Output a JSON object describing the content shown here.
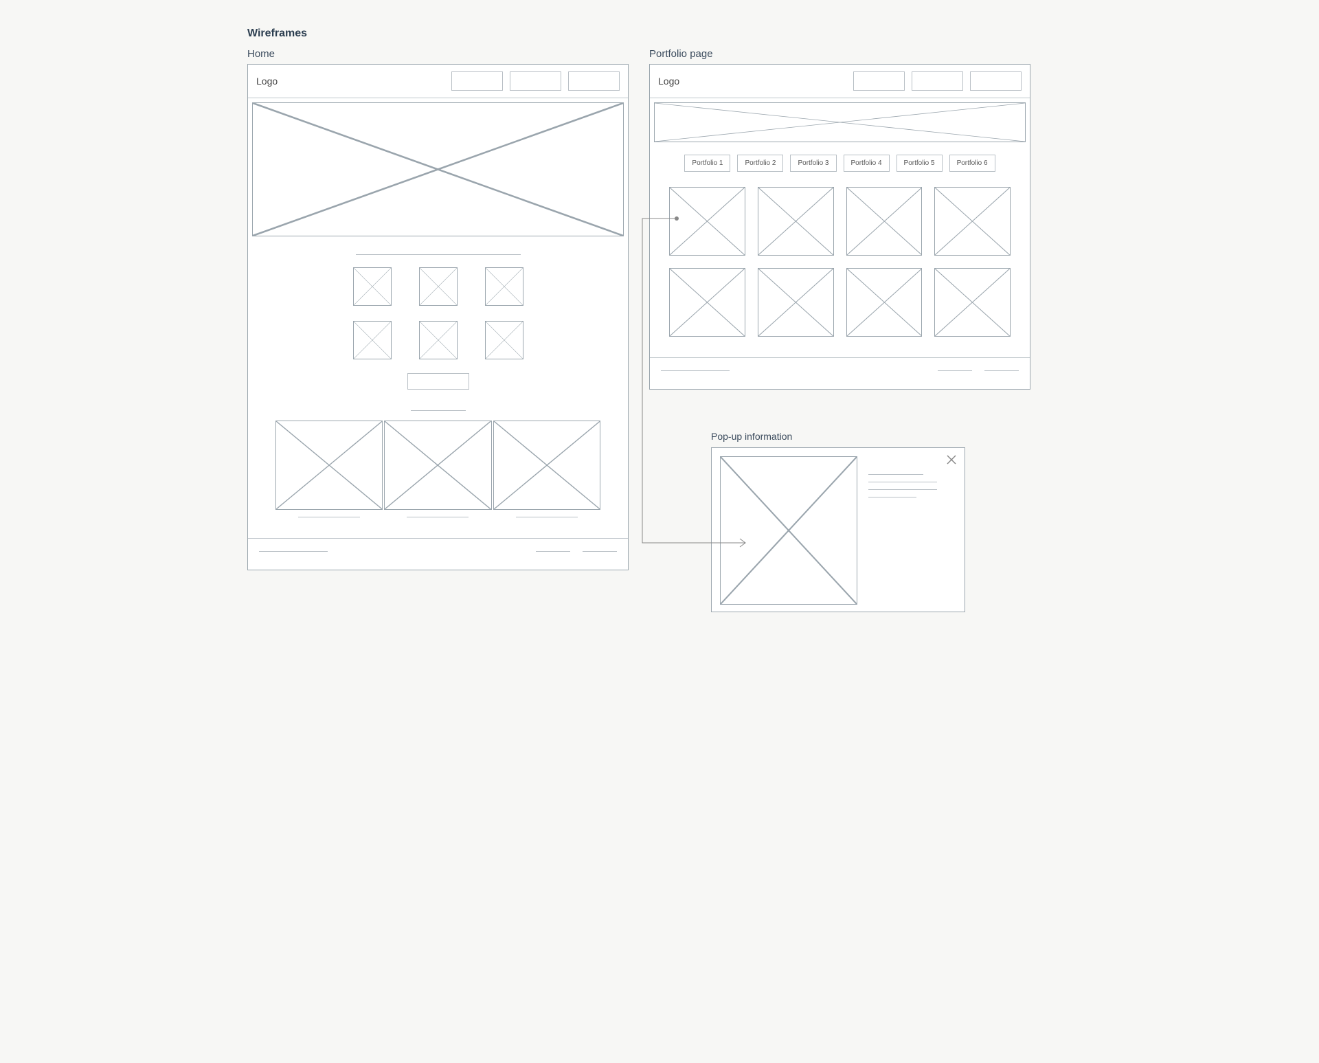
{
  "section_title": "Wireframes",
  "home": {
    "label": "Home",
    "logo": "Logo"
  },
  "portfolio": {
    "label": "Portfolio page",
    "logo": "Logo",
    "tabs": [
      "Portfolio 1",
      "Portfolio 2",
      "Portfolio 3",
      "Portfolio 4",
      "Portfolio 5",
      "Portfolio 6"
    ]
  },
  "popup": {
    "label": "Pop-up information"
  }
}
